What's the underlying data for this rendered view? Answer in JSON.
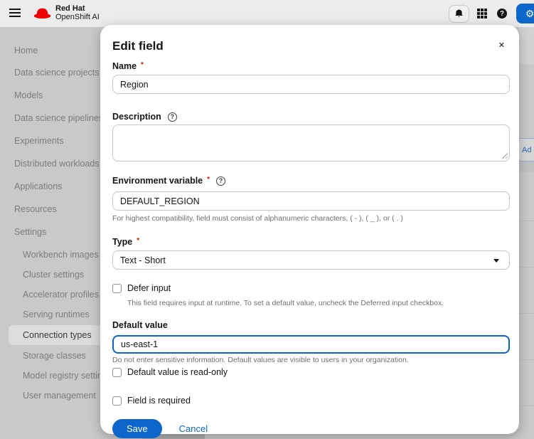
{
  "colors": {
    "primary": "#0d66c9",
    "danger": "#c9190b",
    "backdrop": "#c9c9c9"
  },
  "icons": {
    "help_glyph": "?",
    "close_glyph": "✕",
    "gear_glyph": "⚙"
  },
  "header": {
    "brand_line1": "Red Hat",
    "brand_line2": "OpenShift AI"
  },
  "sidebar": {
    "items": [
      "Home",
      "Data science projects",
      "Models",
      "Data science pipelines",
      "Experiments",
      "Distributed workloads",
      "Applications",
      "Resources",
      "Settings"
    ],
    "settings_subitems": [
      "Workbench images",
      "Cluster settings",
      "Accelerator profiles",
      "Serving runtimes",
      "Connection types",
      "Storage classes",
      "Model registry settings",
      "User management"
    ],
    "selected_item": "Connection types"
  },
  "background_page": {
    "clipped_add_button_text": "Ad"
  },
  "modal": {
    "title": "Edit field",
    "required_marker": "*",
    "name_label": "Name",
    "name_value": "Region",
    "description_label": "Description",
    "description_value": "",
    "env_label": "Environment variable",
    "env_value": "DEFAULT_REGION",
    "env_helper": "For highest compatibility, field must consist of alphanumeric characters, ( - ), ( _ ), or ( . )",
    "type_label": "Type",
    "type_value": "Text - Short",
    "defer_label": "Defer input",
    "defer_checked": false,
    "defer_helper": "This field requires input at runtime. To set a default value, uncheck the Deferred input checkbox.",
    "default_label": "Default value",
    "default_value": "us-east-1",
    "default_helper": "Do not enter sensitive information. Default values are visible to users in your organization.",
    "readonly_label": "Default value is read-only",
    "readonly_checked": false,
    "required_label": "Field is required",
    "required_checked": false,
    "save_label": "Save",
    "cancel_label": "Cancel"
  }
}
